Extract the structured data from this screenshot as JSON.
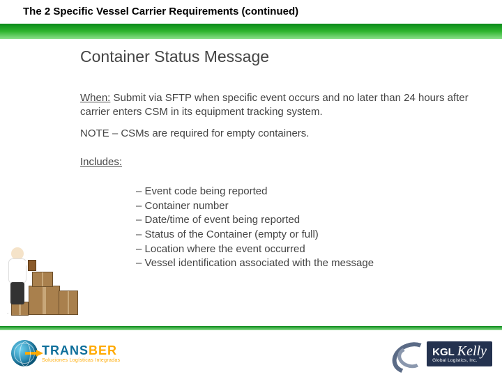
{
  "title": "The 2 Specific Vessel Carrier Requirements (continued)",
  "subtitle": "Container Status Message",
  "when_label": "When:",
  "when_text": " Submit via SFTP when specific event occurs and no later than 24 hours after carrier enters CSM in its equipment tracking system.",
  "note": "NOTE – CSMs are required for empty containers.",
  "includes_label": "Includes:",
  "bullets": [
    "Event code being reported",
    "Container number",
    "Date/time of event being reported",
    "Status of the Container (empty or full)",
    "Location where the event occurred",
    "Vessel identification associated with the message"
  ],
  "logos": {
    "transber": {
      "name_pre": "TRANS",
      "name_post": "BER",
      "tagline": "Soluciones Logísticas Integradas"
    },
    "kgl": {
      "kgl": "KGL",
      "kelly": "Kelly",
      "sub": "Global Logistics, Inc."
    }
  }
}
